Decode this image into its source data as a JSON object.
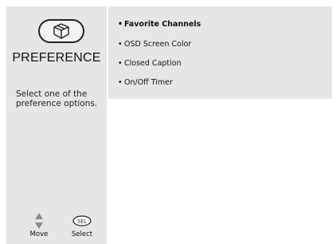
{
  "sidebar": {
    "title": "PREFERENCE",
    "icon": "preference-menu-icon",
    "help_text": "Select one of the preference options.",
    "legend": {
      "move_label": "Move",
      "move_icon": "up-down-arrows-icon",
      "select_label": "Select",
      "select_key": "SEL"
    }
  },
  "options": {
    "bullet": "•",
    "items": [
      {
        "label": "Favorite Channels",
        "selected": true
      },
      {
        "label": "OSD Screen Color",
        "selected": false
      },
      {
        "label": "Closed Caption",
        "selected": false
      },
      {
        "label": "On/Off Timer",
        "selected": false
      }
    ]
  }
}
